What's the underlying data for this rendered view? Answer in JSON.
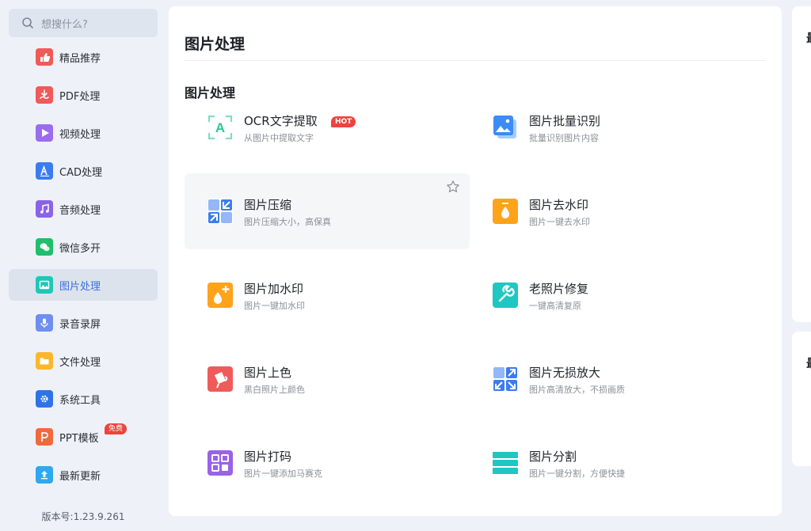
{
  "search": {
    "placeholder": "想搜什么?"
  },
  "sidebar": {
    "items": [
      {
        "label": "精品推荐",
        "icon": "thumbs-up-icon",
        "color": "#f05a5a"
      },
      {
        "label": "PDF处理",
        "icon": "pdf-icon",
        "color": "#f05a5a"
      },
      {
        "label": "视频处理",
        "icon": "play-icon",
        "color": "#9b6cf0"
      },
      {
        "label": "CAD处理",
        "icon": "cad-icon",
        "color": "#3b7cf0"
      },
      {
        "label": "音频处理",
        "icon": "music-icon",
        "color": "#8a63e8"
      },
      {
        "label": "微信多开",
        "icon": "wechat-icon",
        "color": "#1fbf6c"
      },
      {
        "label": "图片处理",
        "icon": "image-icon",
        "color": "#1ec7b8"
      },
      {
        "label": "录音录屏",
        "icon": "microphone-icon",
        "color": "#6e8ff0"
      },
      {
        "label": "文件处理",
        "icon": "folder-icon",
        "color": "#fbb72b"
      },
      {
        "label": "系统工具",
        "icon": "gear-icon",
        "color": "#2f73e8"
      },
      {
        "label": "PPT模板",
        "icon": "ppt-icon",
        "color": "#f06a3c",
        "badge": "免费"
      },
      {
        "label": "最新更新",
        "icon": "update-icon",
        "color": "#2fa8f0"
      }
    ],
    "active_index": 6
  },
  "version": "版本号:1.23.9.261",
  "main": {
    "page_title": "图片处理",
    "section_title": "图片处理",
    "hot_label": "HOT",
    "tools": [
      {
        "name": "OCR文字提取",
        "desc": "从图片中提取文字",
        "icon": "ocr-icon",
        "color": "#2ec79a"
      },
      {
        "name": "图片批量识别",
        "desc": "批量识别图片内容",
        "icon": "batch-image-icon",
        "color": "#3b8cf5"
      },
      {
        "name": "图片压缩",
        "desc": "图片压缩大小，高保真",
        "icon": "compress-icon",
        "color": "#3b7cf0"
      },
      {
        "name": "图片去水印",
        "desc": "图片一键去水印",
        "icon": "remove-watermark-icon",
        "color": "#ffa31a"
      },
      {
        "name": "图片加水印",
        "desc": "图片一键加水印",
        "icon": "add-watermark-icon",
        "color": "#ffa31a"
      },
      {
        "name": "老照片修复",
        "desc": "一键高清复原",
        "icon": "repair-icon",
        "color": "#1ec7c2"
      },
      {
        "name": "图片上色",
        "desc": "黑白照片上颜色",
        "icon": "colorize-icon",
        "color": "#ef5b5b"
      },
      {
        "name": "图片无损放大",
        "desc": "图片高清放大，不损画质",
        "icon": "enlarge-icon",
        "color": "#3b7cf0"
      },
      {
        "name": "图片打码",
        "desc": "图片一键添加马赛克",
        "icon": "mosaic-icon",
        "color": "#9a62e6"
      },
      {
        "name": "图片分割",
        "desc": "图片一键分割，方便快捷",
        "icon": "split-icon",
        "color": "#1ec7c2"
      }
    ]
  },
  "right_panels": [
    {
      "title_fragment": "最"
    },
    {
      "title_fragment": "最"
    }
  ]
}
